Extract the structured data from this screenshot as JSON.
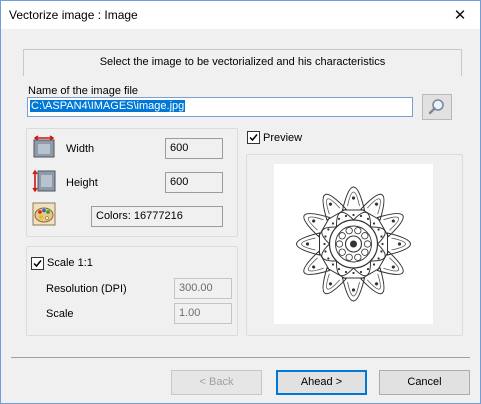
{
  "window": {
    "title": "Vectorize image : Image"
  },
  "header": {
    "text": "Select the image to be vectorialized and his characteristics"
  },
  "file": {
    "label": "Name of the image file",
    "value": "C:\\ASPAN4\\IMAGES\\image.jpg"
  },
  "dimensions": {
    "width_label": "Width",
    "width_value": "600",
    "height_label": "Height",
    "height_value": "600",
    "colors_text": "Colors: 16777216"
  },
  "scale": {
    "checkbox_label": "Scale 1:1",
    "checked": true,
    "resolution_label": "Resolution (DPI)",
    "resolution_value": "300.00",
    "scale_label": "Scale",
    "scale_value": "1.00"
  },
  "preview": {
    "checkbox_label": "Preview",
    "checked": true
  },
  "buttons": {
    "back": "< Back",
    "ahead": "Ahead >",
    "cancel": "Cancel"
  },
  "icons": {
    "close": "close-icon",
    "browse": "magnifier-icon",
    "width": "width-arrow-icon",
    "height": "height-arrow-icon",
    "colors": "palette-icon"
  }
}
